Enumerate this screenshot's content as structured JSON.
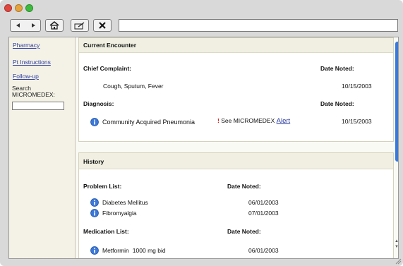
{
  "toolbar": {
    "back_icon": "triangle-left-icon",
    "forward_icon": "triangle-right-icon",
    "home_icon": "home-icon",
    "edit_icon": "pencil-icon",
    "close_icon": "close-icon",
    "address_value": ""
  },
  "sidebar": {
    "links": [
      "Pharmacy",
      "Pt Instructions",
      "Follow-up"
    ],
    "search_label_line1": "Search",
    "search_label_line2": "MICROMEDEX:",
    "search_value": ""
  },
  "encounter": {
    "title": "Current Encounter",
    "chief_complaint_label": "Chief Complaint:",
    "date_noted_label": "Date Noted:",
    "chief_complaint_value": "Cough, Sputum, Fever",
    "chief_complaint_date": "10/15/2003",
    "diagnosis_label": "Diagnosis:",
    "diagnosis_date_label": "Date Noted:",
    "diagnosis_value": "Community Acquired Pneumonia",
    "micromedex_bang": "!",
    "micromedex_text": "See MICROMEDEX",
    "alert_link": "Alert",
    "diagnosis_date": "10/15/2003"
  },
  "history": {
    "title": "History",
    "problem_list_label": "Problem List:",
    "problem_date_label": "Date Noted:",
    "problems": [
      {
        "name": "Diabetes Mellitus",
        "date": "06/01/2003"
      },
      {
        "name": "Fibromyalgia",
        "date": "07/01/2003"
      }
    ],
    "medication_list_label": "Medication List:",
    "medication_date_label": "Date Noted:",
    "medications": [
      {
        "name": "Metformin",
        "dose": "1000 mg bid",
        "date": "06/01/2003"
      }
    ]
  },
  "colors": {
    "accent_blue": "#3b78d8",
    "link_blue": "#2b3ba0",
    "alert_red": "#d2261c",
    "panel_beige": "#f4f2e6"
  }
}
